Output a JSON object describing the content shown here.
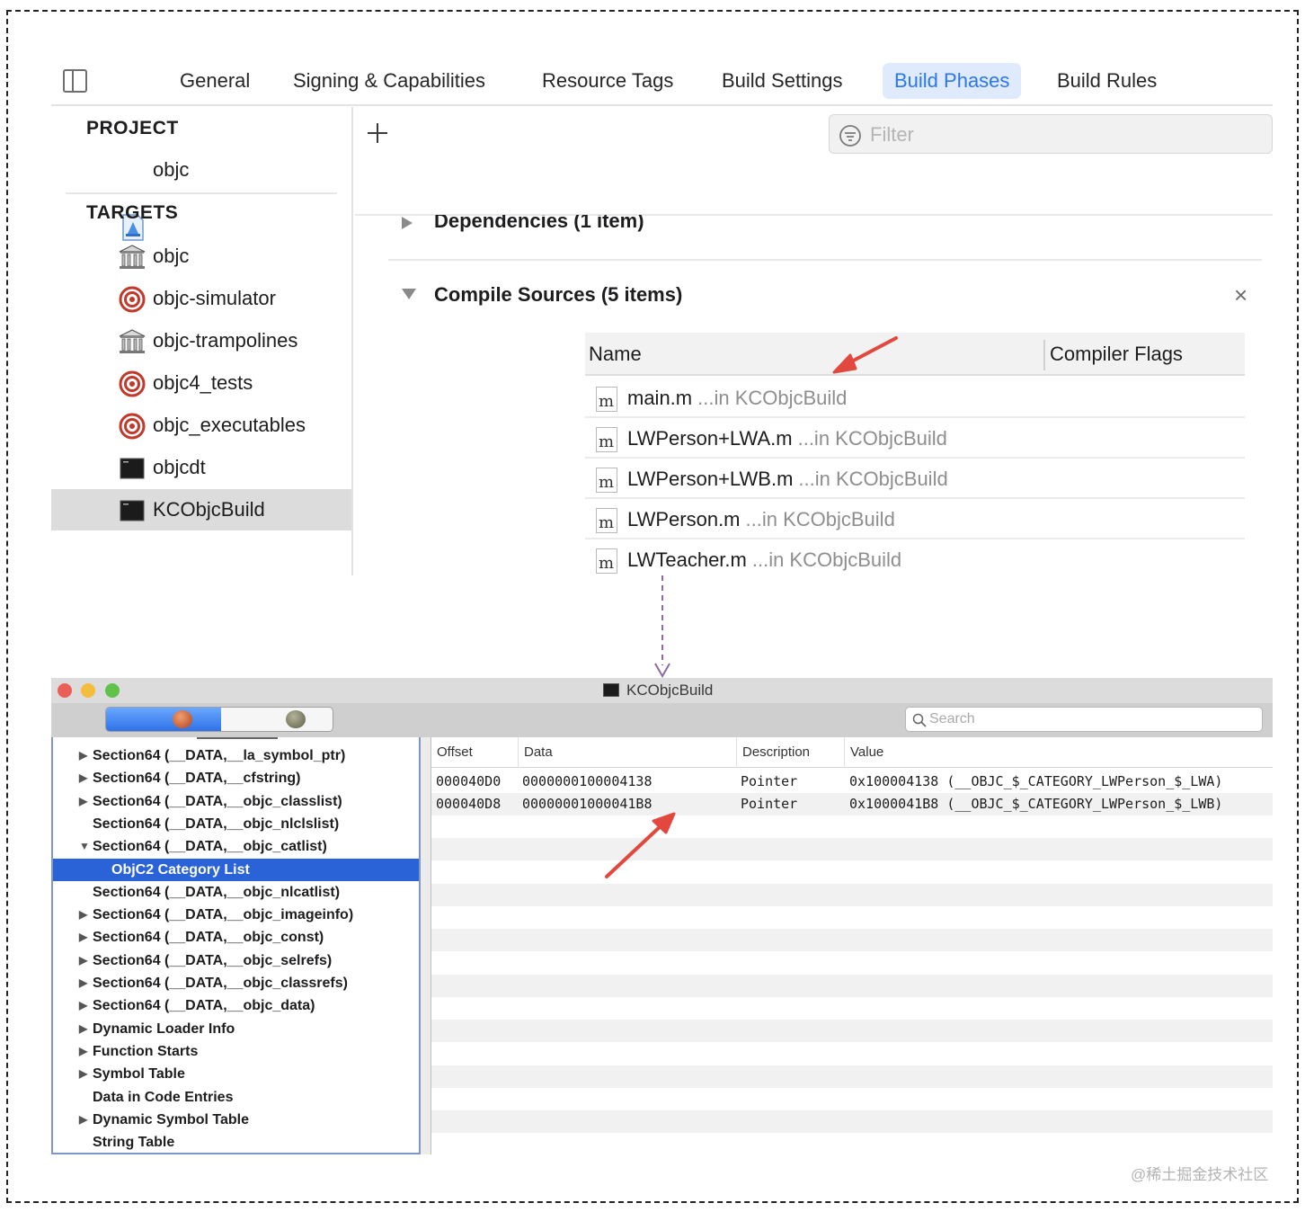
{
  "xcode": {
    "tabs": [
      "General",
      "Signing & Capabilities",
      "Resource Tags",
      "Build Settings",
      "Build Phases",
      "Build Rules"
    ],
    "active_tab": "Build Phases",
    "sidebar": {
      "project_header": "PROJECT",
      "project_item": "objc",
      "targets_header": "TARGETS",
      "targets": [
        "objc",
        "objc-simulator",
        "objc-trampolines",
        "objc4_tests",
        "objc_executables",
        "objcdt",
        "KCObjcBuild"
      ],
      "selected_target": "KCObjcBuild"
    },
    "filter_placeholder": "Filter",
    "dependencies_title": "Dependencies (1 item)",
    "compile_sources_title": "Compile Sources (5 items)",
    "table_headers": {
      "name": "Name",
      "compiler_flags": "Compiler Flags"
    },
    "files": [
      {
        "icon": "m",
        "name": "main.m",
        "location": "...in KCObjcBuild"
      },
      {
        "icon": "m",
        "name": "LWPerson+LWA.m",
        "location": "...in KCObjcBuild"
      },
      {
        "icon": "m",
        "name": "LWPerson+LWB.m",
        "location": "...in KCObjcBuild"
      },
      {
        "icon": "m",
        "name": "LWPerson.m",
        "location": "...in KCObjcBuild"
      },
      {
        "icon": "m",
        "name": "LWTeacher.m",
        "location": "...in KCObjcBuild"
      }
    ],
    "close_glyph": "×",
    "add_glyph": "+",
    "remove_glyph": "—"
  },
  "machoview": {
    "title": "KCObjcBuild",
    "search_placeholder": "Search",
    "tree": [
      {
        "label": "Section64 (__DATA,__la_symbol_ptr)",
        "expander": "▶",
        "indent": 1
      },
      {
        "label": "Section64 (__DATA,__cfstring)",
        "expander": "▶",
        "indent": 1
      },
      {
        "label": "Section64 (__DATA,__objc_classlist)",
        "expander": "▶",
        "indent": 1
      },
      {
        "label": "Section64 (__DATA,__objc_nlclslist)",
        "expander": "",
        "indent": 1
      },
      {
        "label": "Section64 (__DATA,__objc_catlist)",
        "expander": "▼",
        "indent": 1
      },
      {
        "label": "ObjC2 Category List",
        "expander": "",
        "indent": 2,
        "selected": true
      },
      {
        "label": "Section64 (__DATA,__objc_nlcatlist)",
        "expander": "",
        "indent": 1
      },
      {
        "label": "Section64 (__DATA,__objc_imageinfo)",
        "expander": "▶",
        "indent": 1
      },
      {
        "label": "Section64 (__DATA,__objc_const)",
        "expander": "▶",
        "indent": 1
      },
      {
        "label": "Section64 (__DATA,__objc_selrefs)",
        "expander": "▶",
        "indent": 1
      },
      {
        "label": "Section64 (__DATA,__objc_classrefs)",
        "expander": "▶",
        "indent": 1
      },
      {
        "label": "Section64 (__DATA,__objc_data)",
        "expander": "▶",
        "indent": 1
      },
      {
        "label": "Dynamic Loader Info",
        "expander": "▶",
        "indent": 1
      },
      {
        "label": "Function Starts",
        "expander": "▶",
        "indent": 1
      },
      {
        "label": "Symbol Table",
        "expander": "▶",
        "indent": 1
      },
      {
        "label": "Data in Code Entries",
        "expander": "",
        "indent": 1
      },
      {
        "label": "Dynamic Symbol Table",
        "expander": "▶",
        "indent": 1
      },
      {
        "label": "String Table",
        "expander": "",
        "indent": 1
      }
    ],
    "columns": [
      "Offset",
      "Data",
      "Description",
      "Value"
    ],
    "rows": [
      {
        "offset": "000040D0",
        "data": "0000000100004138",
        "description": "Pointer",
        "value": "0x100004138 (__OBJC_$_CATEGORY_LWPerson_$_LWA)"
      },
      {
        "offset": "000040D8",
        "data": "00000001000041B8",
        "description": "Pointer",
        "value": "0x1000041B8 (__OBJC_$_CATEGORY_LWPerson_$_LWB)"
      }
    ]
  },
  "watermark": "@稀土掘金技术社区",
  "colors": {
    "accent": "#2a77ee",
    "selection": "#2a62d8",
    "annotation_arrow": "#e2483d",
    "connector": "#8b6aa8"
  }
}
